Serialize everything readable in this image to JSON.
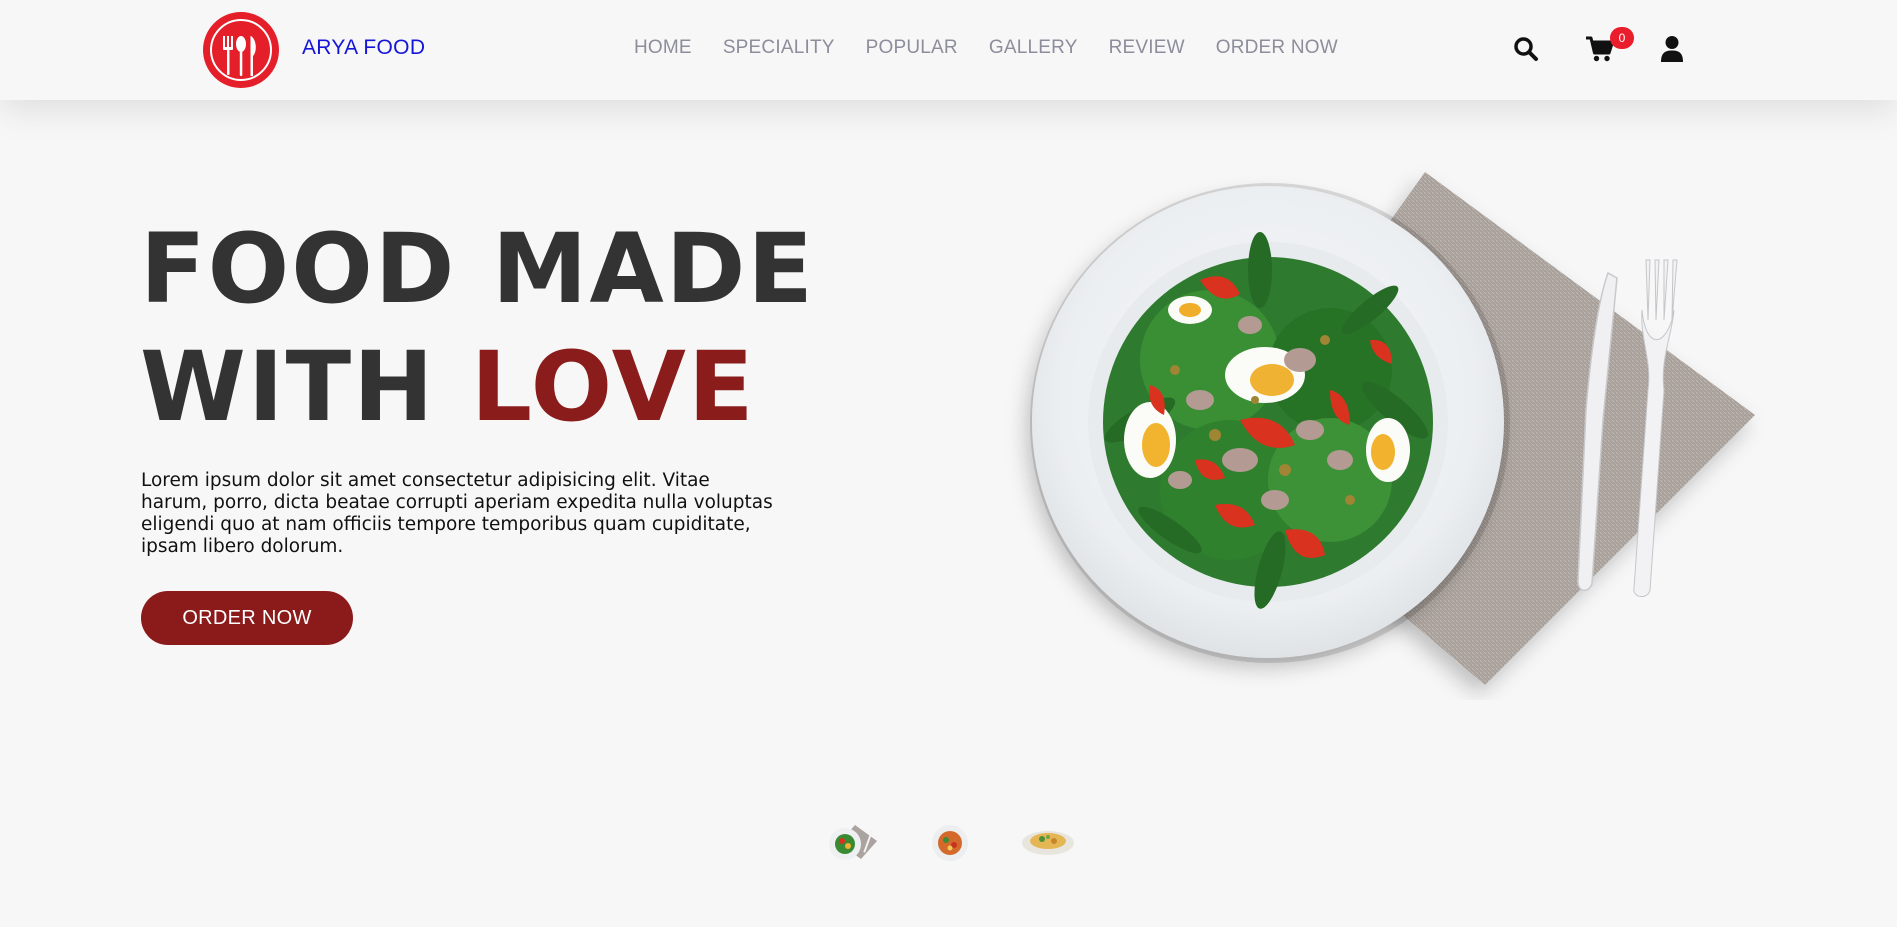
{
  "header": {
    "brand": "ARYA FOOD",
    "logo_icon": "restaurant-utensils-icon",
    "nav": [
      "HOME",
      "SPECIALITY",
      "POPULAR",
      "GALLERY",
      "REVIEW",
      "ORDER NOW"
    ],
    "cart_count": "0",
    "icons": [
      "search-icon",
      "cart-icon",
      "user-icon"
    ]
  },
  "hero": {
    "title_line1": "FOOD MADE",
    "title_line2_a": "WITH",
    "title_line2_b": "LOVE",
    "text": "Lorem ipsum dolor sit amet consectetur adipisicing elit. Vitae harum, porro, dicta beatae corrupti aperiam expedita nulla voluptas eligendi quo at nam officiis tempore temporibus quam cupiditate, ipsam libero dolorum.",
    "button": "ORDER NOW"
  },
  "colors": {
    "brand_red": "#e41f2a",
    "accent_maroon": "#8b1b1b",
    "brand_link": "#1515d8",
    "nav_gray": "#8d8d9c"
  }
}
